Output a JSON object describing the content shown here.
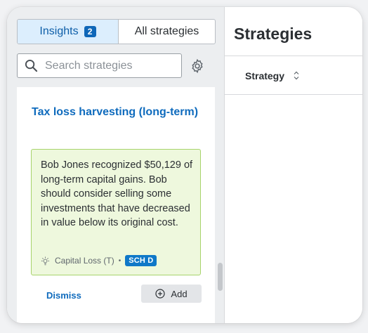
{
  "tabs": {
    "insights_label": "Insights",
    "insights_count": "2",
    "all_label": "All strategies"
  },
  "search": {
    "placeholder": "Search strategies"
  },
  "card": {
    "title": "Tax loss harvesting (long-term)",
    "body": "Bob Jones recognized $50,129 of long-term capital gains. Bob should consider selling some investments that have decreased in value below its original cost.",
    "meta_label": "Capital Loss (T)",
    "separator": "•",
    "schedule_badge": "SCH D",
    "dismiss_label": "Dismiss",
    "add_label": "Add"
  },
  "right": {
    "title": "Strategies",
    "column_header": "Strategy"
  },
  "colors": {
    "accent": "#0f6bbd",
    "tab_active_bg": "#dceefd",
    "insight_bg": "#eef8dd",
    "insight_border": "#a7d36b",
    "badge_bg": "#0f78c8"
  },
  "icons": [
    "search-icon",
    "gear-icon",
    "lightbulb-icon",
    "plus-circle-icon",
    "sort-icon"
  ]
}
